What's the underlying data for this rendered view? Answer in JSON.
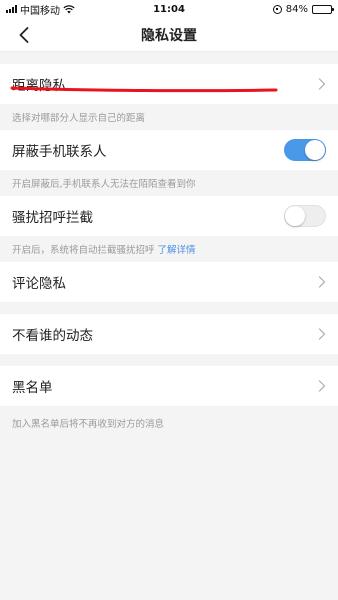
{
  "status_bar": {
    "carrier": "中国移动",
    "time": "11:04",
    "battery": "84%",
    "battery_level": 0.84
  },
  "nav": {
    "title": "隐私设置",
    "back_icon": "chevron-left-icon"
  },
  "settings": {
    "distance": {
      "label": "距离隐私",
      "note": "选择对哪部分人显示自己的距离"
    },
    "block_contacts": {
      "label": "屏蔽手机联系人",
      "toggle_on": true,
      "note": "开启屏蔽后,手机联系人无法在陌陌查看到你"
    },
    "harassment": {
      "label": "骚扰招呼拦截",
      "toggle_on": false,
      "note": "开启后，系统将自动拦截骚扰招呼",
      "note_link": "了解详情"
    },
    "comment": {
      "label": "评论隐私"
    },
    "feed": {
      "label": "不看谁的动态"
    },
    "blacklist": {
      "label": "黑名单",
      "note": "加入黑名单后将不再收到对方的消息"
    }
  },
  "colors": {
    "toggle_on": "#4a98e8",
    "link": "#4a90e2",
    "annotation": "#e8141c",
    "background": "#f4f4f4"
  }
}
